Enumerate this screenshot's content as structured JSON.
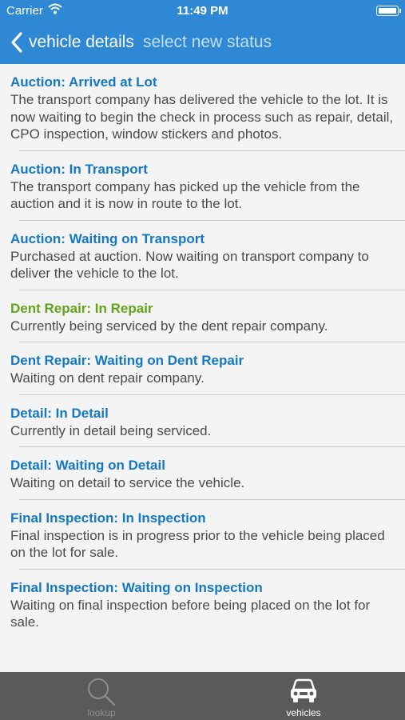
{
  "status_bar": {
    "carrier": "Carrier",
    "time": "11:49 PM"
  },
  "nav": {
    "back_label": "vehicle details",
    "title": "select new status"
  },
  "colors": {
    "accent_blue": "#2e88d4",
    "link_blue": "#1478c6",
    "active_green": "#62a51a",
    "tab_bar": "#5a5a5a"
  },
  "statuses": [
    {
      "title": "Auction: Arrived at Lot",
      "description": "The transport company has delivered the vehicle to the lot. It is now waiting to begin the check in process such as repair, detail, CPO inspection, window stickers and photos.",
      "active": false
    },
    {
      "title": "Auction: In Transport",
      "description": "The transport company has picked up the vehicle from the auction and it is now in route to the lot.",
      "active": false
    },
    {
      "title": "Auction: Waiting on Transport",
      "description": "Purchased at auction. Now waiting on transport company to deliver the vehicle to the lot.",
      "active": false
    },
    {
      "title": "Dent Repair: In Repair",
      "description": "Currently being serviced by the dent repair company.",
      "active": true
    },
    {
      "title": "Dent Repair: Waiting on Dent Repair",
      "description": "Waiting on dent repair company.",
      "active": false
    },
    {
      "title": "Detail: In Detail",
      "description": "Currently in detail being serviced.",
      "active": false
    },
    {
      "title": "Detail: Waiting on Detail",
      "description": "Waiting on detail to service the vehicle.",
      "active": false
    },
    {
      "title": "Final Inspection: In Inspection",
      "description": "Final inspection is in progress prior to the vehicle being placed on the lot for sale.",
      "active": false
    },
    {
      "title": "Final Inspection: Waiting on Inspection",
      "description": "Waiting on final inspection before being placed on the lot for sale.",
      "active": false
    }
  ],
  "tabs": {
    "lookup": {
      "label": "lookup",
      "icon": "magnifier-icon",
      "selected": false
    },
    "vehicles": {
      "label": "vehicles",
      "icon": "car-icon",
      "selected": true
    }
  }
}
